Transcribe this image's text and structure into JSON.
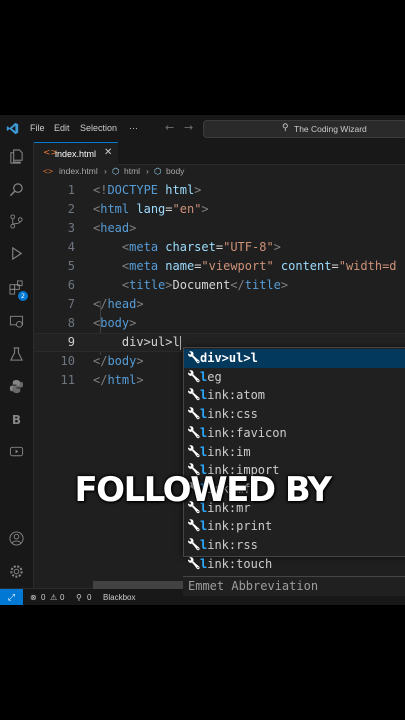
{
  "titlebar": {
    "menu": [
      "File",
      "Edit",
      "Selection",
      "···"
    ],
    "search_text": "The Coding Wizard"
  },
  "tab": {
    "label": "index.html",
    "close": "✕"
  },
  "breadcrumb": [
    "index.html",
    "html",
    "body"
  ],
  "code_lines": [
    {
      "num": "1",
      "parts": [
        [
          "p",
          "<!"
        ],
        [
          "t",
          "DOCTYPE"
        ],
        [
          "x",
          " "
        ],
        [
          "a",
          "html"
        ],
        [
          "p",
          ">"
        ]
      ]
    },
    {
      "num": "2",
      "parts": [
        [
          "p",
          "<"
        ],
        [
          "t",
          "html"
        ],
        [
          "x",
          " "
        ],
        [
          "a",
          "lang"
        ],
        [
          "x",
          "="
        ],
        [
          "s",
          "\"en\""
        ],
        [
          "p",
          ">"
        ]
      ]
    },
    {
      "num": "3",
      "parts": [
        [
          "p",
          "<"
        ],
        [
          "t",
          "head"
        ],
        [
          "p",
          ">"
        ]
      ]
    },
    {
      "num": "4",
      "parts": [
        [
          "x",
          "    "
        ],
        [
          "p",
          "<"
        ],
        [
          "t",
          "meta"
        ],
        [
          "x",
          " "
        ],
        [
          "a",
          "charset"
        ],
        [
          "x",
          "="
        ],
        [
          "s",
          "\"UTF-8\""
        ],
        [
          "p",
          ">"
        ]
      ]
    },
    {
      "num": "5",
      "parts": [
        [
          "x",
          "    "
        ],
        [
          "p",
          "<"
        ],
        [
          "t",
          "meta"
        ],
        [
          "x",
          " "
        ],
        [
          "a",
          "name"
        ],
        [
          "x",
          "="
        ],
        [
          "s",
          "\"viewport\""
        ],
        [
          "x",
          " "
        ],
        [
          "a",
          "content"
        ],
        [
          "x",
          "="
        ],
        [
          "s",
          "\"width=d"
        ]
      ]
    },
    {
      "num": "6",
      "parts": [
        [
          "x",
          "    "
        ],
        [
          "p",
          "<"
        ],
        [
          "t",
          "title"
        ],
        [
          "p",
          ">"
        ],
        [
          "x",
          "Document"
        ],
        [
          "p",
          "</"
        ],
        [
          "t",
          "title"
        ],
        [
          "p",
          ">"
        ]
      ]
    },
    {
      "num": "7",
      "parts": [
        [
          "p",
          "</"
        ],
        [
          "t",
          "head"
        ],
        [
          "p",
          ">"
        ]
      ]
    },
    {
      "num": "8",
      "parts": [
        [
          "p",
          "<"
        ],
        [
          "t",
          "body"
        ],
        [
          "p",
          ">"
        ]
      ]
    },
    {
      "num": "9",
      "parts": [
        [
          "x",
          "    div>ul>l"
        ]
      ],
      "active": true
    },
    {
      "num": "10",
      "parts": [
        [
          "p",
          "</"
        ],
        [
          "t",
          "body"
        ],
        [
          "p",
          ">"
        ]
      ]
    },
    {
      "num": "11",
      "parts": [
        [
          "p",
          "</"
        ],
        [
          "t",
          "html"
        ],
        [
          "p",
          ">"
        ]
      ]
    }
  ],
  "suggestions": [
    {
      "hl": "div>ul>l",
      "rest": ""
    },
    {
      "hl": "l",
      "rest": "eg"
    },
    {
      "hl": "l",
      "rest": "ink:atom"
    },
    {
      "hl": "l",
      "rest": "ink:css"
    },
    {
      "hl": "l",
      "rest": "ink:favicon"
    },
    {
      "hl": "l",
      "rest": "ink:im"
    },
    {
      "hl": "l",
      "rest": "ink:import"
    },
    {
      "hl": "l",
      "rest": "ink:mf"
    },
    {
      "hl": "l",
      "rest": "ink:mr"
    },
    {
      "hl": "l",
      "rest": "ink:print"
    },
    {
      "hl": "l",
      "rest": "ink:rss"
    },
    {
      "hl": "l",
      "rest": "ink:touch"
    }
  ],
  "suggest_detail": "Emmet Abbreviation",
  "statusbar": {
    "errors": "0",
    "warnings": "0",
    "ports": "0",
    "extension": "Blackbox"
  },
  "overlay_caption": "FOLLOWED BY",
  "colors": {
    "accent": "#0078d4",
    "tag": "#569cd6",
    "attr": "#9cdcfe",
    "string": "#ce9178"
  }
}
